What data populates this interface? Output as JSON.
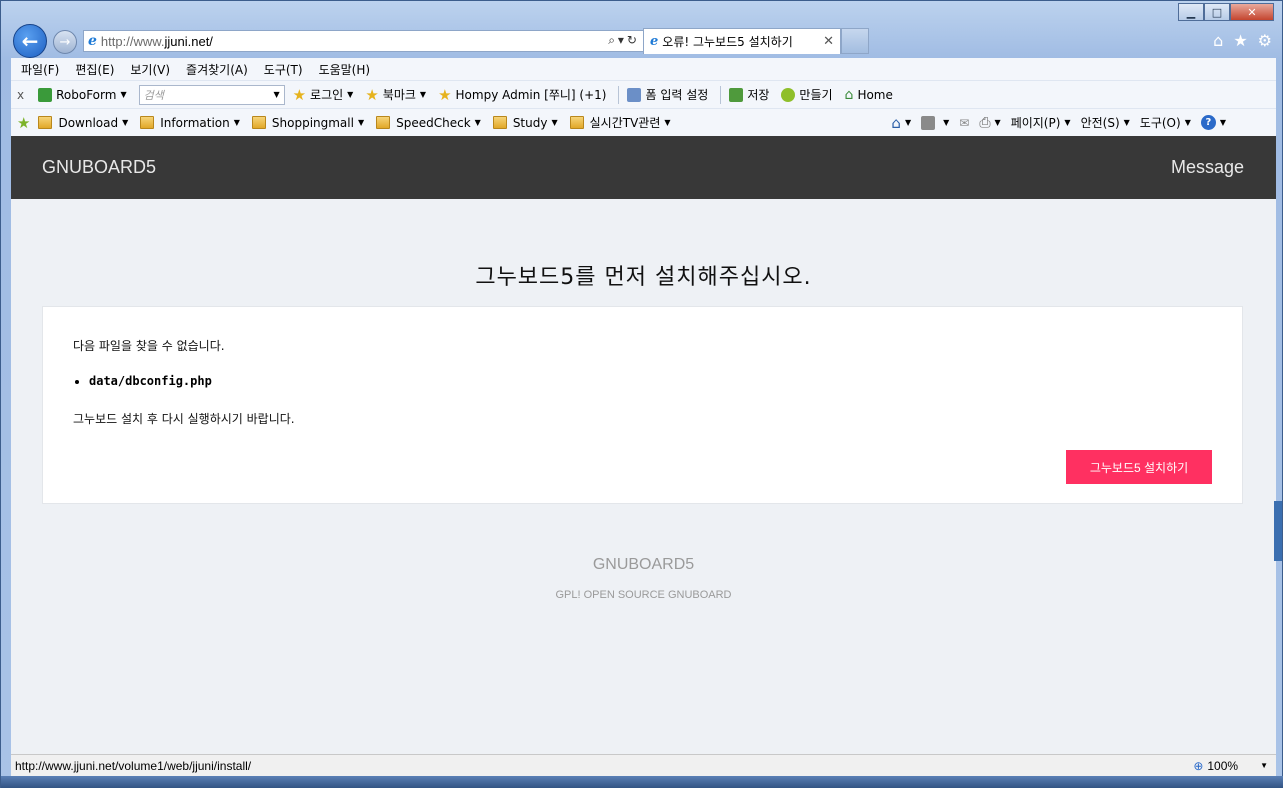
{
  "window": {
    "caption_min": "▁",
    "caption_max": "□",
    "caption_close": "✕"
  },
  "nav": {
    "address_prefix": "http://www.",
    "address_host": "jjuni.net/",
    "address_tools": "⌕▾↻",
    "tab_title": "오류! 그누보드5 설치하기",
    "tab_close": "✕",
    "home_icon": "⌂",
    "favorites_icon": "★",
    "tools_icon": "⚙"
  },
  "menubar": {
    "items": [
      "파일(F)",
      "편집(E)",
      "보기(V)",
      "즐겨찾기(A)",
      "도구(T)",
      "도움말(H)"
    ]
  },
  "toolbar": {
    "close": "x",
    "roboform": "RoboForm",
    "search_placeholder": "검색",
    "login": "로그인",
    "bookmark": "북마크",
    "hompy_admin": "Hompy Admin [쭈니] (+1)",
    "form_settings": "폼 입력 설정",
    "save": "저장",
    "make": "만들기",
    "home": "Home"
  },
  "favbar": {
    "folders": [
      "Download",
      "Information",
      "Shoppingmall",
      "SpeedCheck",
      "Study",
      "실시간TV관련"
    ],
    "page": "페이지(P)",
    "safety": "안전(S)",
    "tools": "도구(O)",
    "help": "?"
  },
  "site": {
    "brand": "GNUBOARD5",
    "message_link": "Message",
    "title": "그누보드5를 먼저 설치해주십시오.",
    "notice": "다음 파일을 찾을 수 없습니다.",
    "missing_file": "data/dbconfig.php",
    "instruction": "그누보드 설치 후 다시 실행하시기 바랍니다.",
    "install_button": "그누보드5 설치하기",
    "footer_title": "GNUBOARD5",
    "footer_sub": "GPL! OPEN SOURCE GNUBOARD"
  },
  "status": {
    "url": "http://www.jjuni.net/volume1/web/jjuni/install/",
    "zoom": "100%"
  },
  "colors": {
    "header_bg": "#383838",
    "install_button_bg": "#ff3061",
    "content_bg": "#eef1f5"
  }
}
